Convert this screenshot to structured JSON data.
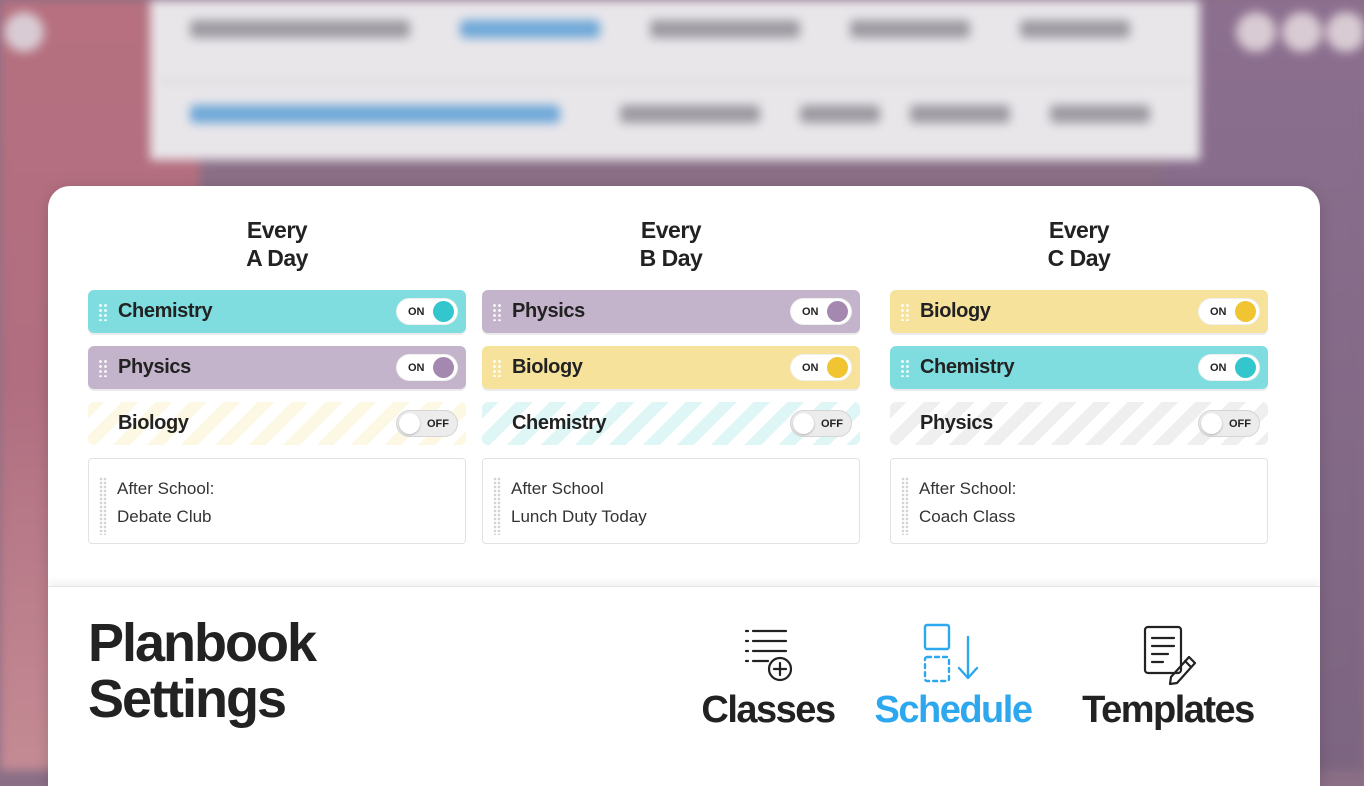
{
  "columns": [
    {
      "heading_line1": "Every",
      "heading_line2": "A Day",
      "rows": [
        {
          "label": "Chemistry",
          "state": "ON"
        },
        {
          "label": "Physics",
          "state": "ON"
        },
        {
          "label": "Biology",
          "state": "OFF"
        }
      ],
      "note_line1": "After School:",
      "note_line2": "Debate Club"
    },
    {
      "heading_line1": "Every",
      "heading_line2": "B Day",
      "rows": [
        {
          "label": "Physics",
          "state": "ON"
        },
        {
          "label": "Biology",
          "state": "ON"
        },
        {
          "label": "Chemistry",
          "state": "OFF"
        }
      ],
      "note_line1": "After School",
      "note_line2": "Lunch Duty Today"
    },
    {
      "heading_line1": "Every",
      "heading_line2": "C Day",
      "rows": [
        {
          "label": "Biology",
          "state": "ON"
        },
        {
          "label": "Chemistry",
          "state": "ON"
        },
        {
          "label": "Physics",
          "state": "OFF"
        }
      ],
      "note_line1": "After School:",
      "note_line2": "Coach Class"
    }
  ],
  "class_colors": {
    "Chemistry": "#7fdde0",
    "Physics": "#c3b4cc",
    "Biology": "#f6e29a",
    "Chemistry_knob": "#33c6cc",
    "Physics_knob": "#a488b0",
    "Biology_knob": "#f0c531"
  },
  "footer": {
    "title_line1": "Planbook",
    "title_line2": "Settings",
    "tabs": [
      {
        "label": "Classes",
        "icon": "list-add-icon",
        "active": false
      },
      {
        "label": "Schedule",
        "icon": "schedule-move-icon",
        "active": true
      },
      {
        "label": "Templates",
        "icon": "template-edit-icon",
        "active": false
      }
    ],
    "active_color": "#2da8ee"
  }
}
